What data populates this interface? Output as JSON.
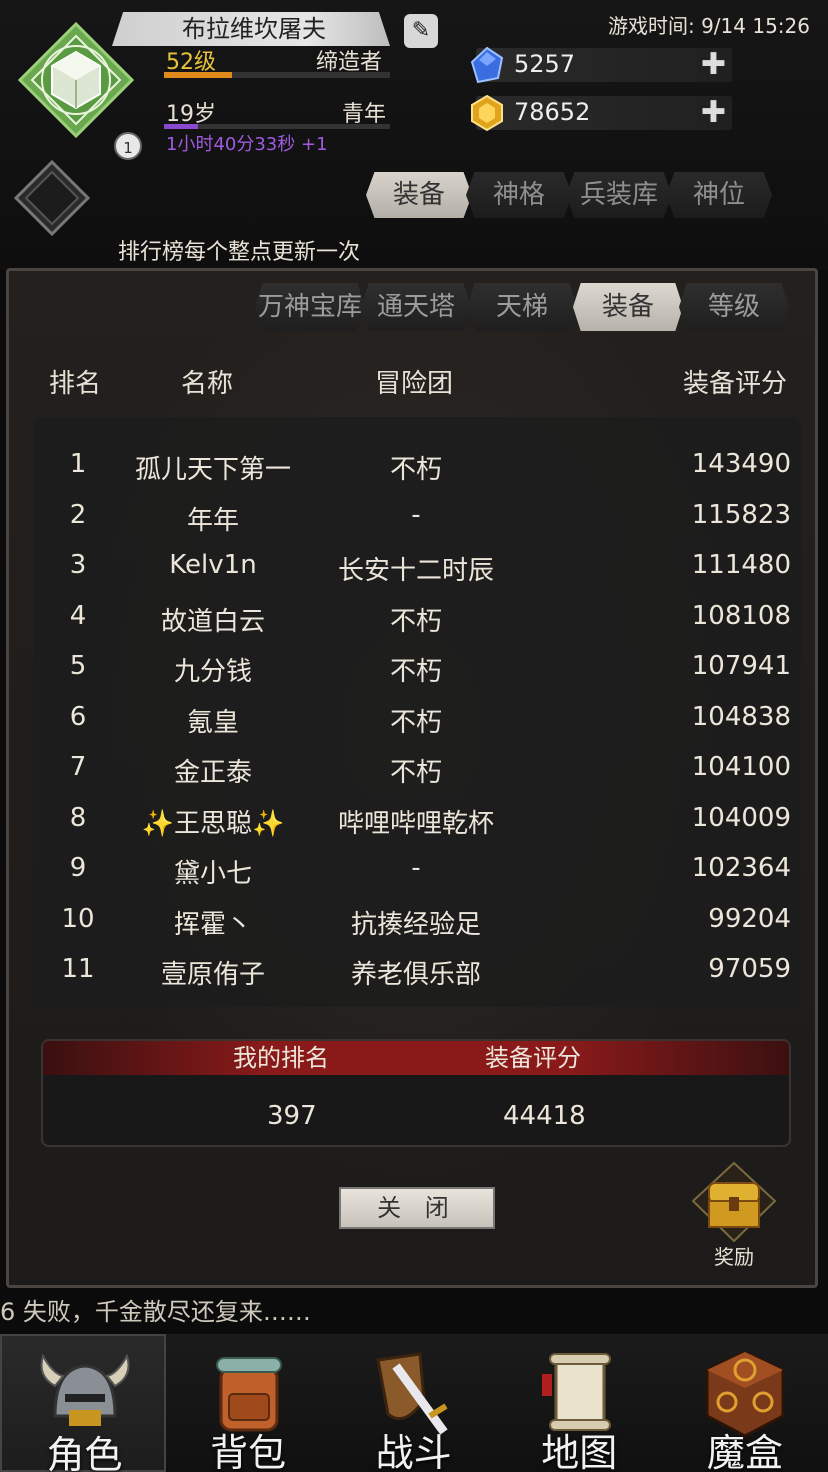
{
  "player": {
    "name": "布拉维坎屠夫",
    "level": "52级",
    "title": "缔造者",
    "xp_progress": 0.3,
    "age": "19岁",
    "age_stage": "青年",
    "age_progress": 0.15,
    "timer": "1小时40分33秒 +1",
    "avatar_badge": "1"
  },
  "game_time": "游戏时间: 9/14 15:26",
  "currencies": [
    {
      "icon": "blue-gem-icon",
      "value": "5257"
    },
    {
      "icon": "gold-gem-icon",
      "value": "78652"
    }
  ],
  "notice": "排行榜每个整点更新一次",
  "main_tabs": [
    "装备",
    "神格",
    "兵装库",
    "神位"
  ],
  "main_tab_active": "装备",
  "sub_tabs": [
    "万神宝库",
    "通天塔",
    "天梯",
    "装备",
    "等级"
  ],
  "sub_tab_active": "装备",
  "columns": {
    "rank": "排名",
    "name": "名称",
    "team": "冒险团",
    "score": "装备评分"
  },
  "rows": [
    {
      "rank": "1",
      "name": "孤儿天下第一",
      "team": "不朽",
      "score": "143490"
    },
    {
      "rank": "2",
      "name": "年年",
      "team": "-",
      "score": "115823"
    },
    {
      "rank": "3",
      "name": "Kelv1n",
      "team": "长安十二时辰",
      "score": "111480"
    },
    {
      "rank": "4",
      "name": "故道白云",
      "team": "不朽",
      "score": "108108"
    },
    {
      "rank": "5",
      "name": "九分钱",
      "team": "不朽",
      "score": "107941"
    },
    {
      "rank": "6",
      "name": "氪皇",
      "team": "不朽",
      "score": "104838"
    },
    {
      "rank": "7",
      "name": "金正泰",
      "team": "不朽",
      "score": "104100"
    },
    {
      "rank": "8",
      "name": "✨王思聪✨",
      "team": "哔哩哔哩乾杯",
      "score": "104009"
    },
    {
      "rank": "9",
      "name": "黛小七",
      "team": "-",
      "score": "102364"
    },
    {
      "rank": "10",
      "name": "挥霍丶",
      "team": "抗揍经验足",
      "score": "99204"
    },
    {
      "rank": "11",
      "name": "壹原侑子",
      "team": "养老俱乐部",
      "score": "97059"
    }
  ],
  "my_rank": {
    "rank_label": "我的排名",
    "score_label": "装备评分",
    "rank": "397",
    "score": "44418"
  },
  "close_label": "关 闭",
  "reward_label": "奖励",
  "ticker": "6 失败，千金散尽还复来……",
  "nav": [
    {
      "label": "角色",
      "icon": "helmet-icon"
    },
    {
      "label": "背包",
      "icon": "backpack-icon"
    },
    {
      "label": "战斗",
      "icon": "sword-shield-icon"
    },
    {
      "label": "地图",
      "icon": "scroll-map-icon"
    },
    {
      "label": "魔盒",
      "icon": "magic-box-icon"
    }
  ],
  "nav_active": "角色"
}
